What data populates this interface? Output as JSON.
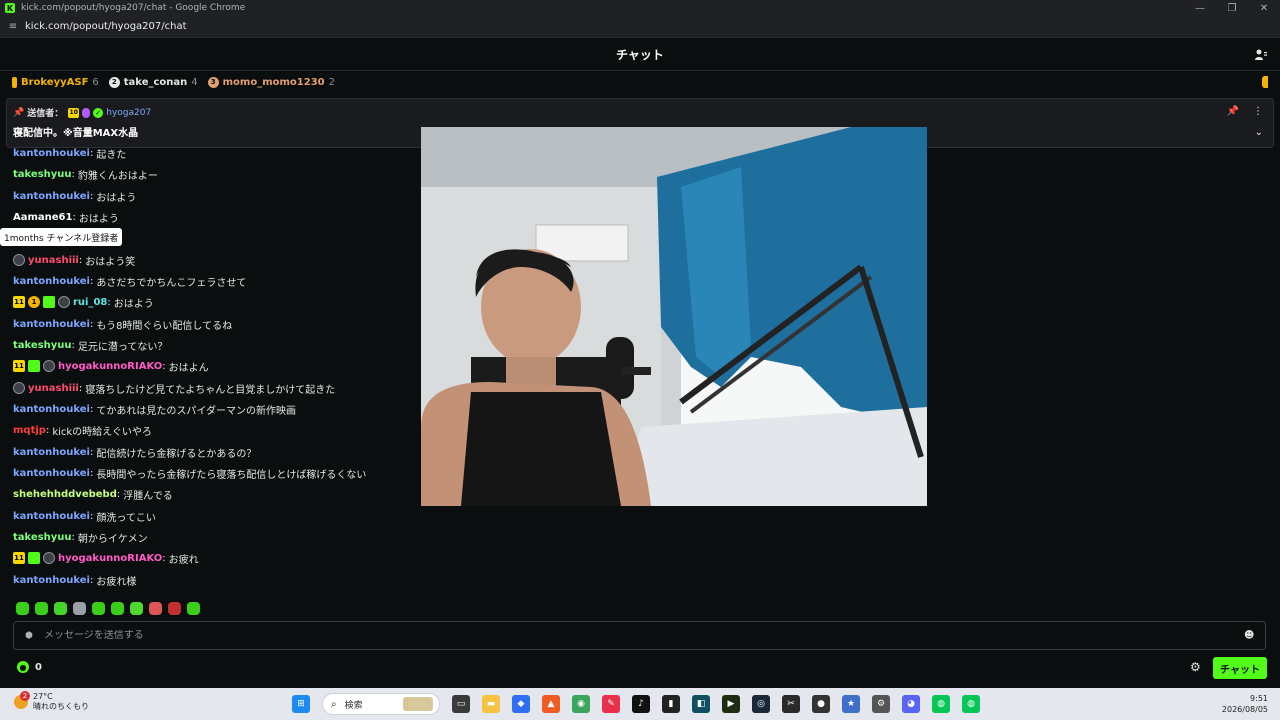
{
  "browser": {
    "window_title": "kick.com/popout/hyoga207/chat - Google Chrome",
    "url": "kick.com/popout/hyoga207/chat"
  },
  "header": {
    "title": "チャット"
  },
  "leaderboard": [
    {
      "rank": "",
      "name": "BrokeyyASF",
      "count": "6",
      "color": "#f5b400"
    },
    {
      "rank": "2",
      "name": "take_conan",
      "count": "4",
      "color": "#e6e6e6"
    },
    {
      "rank": "3",
      "name": "momo_momo1230",
      "count": "2",
      "color": "#e0a070"
    }
  ],
  "pinned": {
    "sender_label": "送信者：",
    "sub_badge": "10",
    "username": "hyoga207",
    "message": "寝配信中。※音量MAX水晶"
  },
  "tooltip": "1months チャンネル登録者",
  "messages": [
    {
      "badges": [],
      "user": "kantonhoukei",
      "color": "#7ea6ff",
      "text": "起きた"
    },
    {
      "badges": [],
      "user": "takeshyuu",
      "color": "#7cff7c",
      "text": "豹雅くんおはよー"
    },
    {
      "badges": [],
      "user": "kantonhoukei",
      "color": "#7ea6ff",
      "text": "おはよう"
    },
    {
      "badges": [],
      "user": "Aamane61",
      "color": "#ffffff",
      "text": "おはよう"
    },
    {
      "badges": [
        "avatar"
      ],
      "user": "yunashiii",
      "color": "#ff4d6d",
      "text": "おはよう笑"
    },
    {
      "badges": [],
      "user": "kantonhoukei",
      "color": "#7ea6ff",
      "text": "あさだちでかちんこフェラさせて"
    },
    {
      "badges": [
        "sub11",
        "gold",
        "gift",
        "avatar"
      ],
      "user": "rui_08",
      "color": "#5ee6e6",
      "text": "おはよう"
    },
    {
      "badges": [],
      "user": "kantonhoukei",
      "color": "#7ea6ff",
      "text": "もう8時間ぐらい配信してるね"
    },
    {
      "badges": [],
      "user": "takeshyuu",
      "color": "#7cff7c",
      "text": "足元に潜ってない？"
    },
    {
      "badges": [
        "sub11",
        "gift",
        "avatar"
      ],
      "user": "hyogakunnoRIAKO",
      "color": "#ff5ac8",
      "text": "おはよん"
    },
    {
      "badges": [
        "avatar"
      ],
      "user": "yunashiii",
      "color": "#ff4d6d",
      "text": "寝落ちしたけど見てたよちゃんと目覚ましかけて起きた"
    },
    {
      "badges": [],
      "user": "kantonhoukei",
      "color": "#7ea6ff",
      "text": "てかあれは見たのスパイダーマンの新作映画"
    },
    {
      "badges": [],
      "user": "mqtjp",
      "color": "#ff3b3b",
      "text": "kickの時給えぐいやろ"
    },
    {
      "badges": [],
      "user": "kantonhoukei",
      "color": "#7ea6ff",
      "text": "配信続けたら金稼げるとかあるの？"
    },
    {
      "badges": [],
      "user": "kantonhoukei",
      "color": "#7ea6ff",
      "text": "長時間やったら金稼げたら寝落ち配信しとけば稼げるくない"
    },
    {
      "badges": [],
      "user": "shehehhddvebebd",
      "color": "#c6ff7c",
      "text": "浮腫んでる"
    },
    {
      "badges": [],
      "user": "kantonhoukei",
      "color": "#7ea6ff",
      "text": "顔洗ってこい"
    },
    {
      "badges": [],
      "user": "takeshyuu",
      "color": "#7cff7c",
      "text": "朝からイケメン"
    },
    {
      "badges": [
        "sub11",
        "gift",
        "avatar"
      ],
      "user": "hyogakunnoRIAKO",
      "color": "#ff5ac8",
      "text": "お疲れ"
    },
    {
      "badges": [],
      "user": "kantonhoukei",
      "color": "#7ea6ff",
      "text": "お疲れ様"
    }
  ],
  "badge_labels": {
    "sub11": "11",
    "gold": "1",
    "gift": "",
    "avatar": ""
  },
  "input": {
    "placeholder": "メッセージを送信する"
  },
  "footer": {
    "points": "0",
    "send_label": "チャット"
  },
  "taskbar": {
    "notification_count": "2",
    "temperature": "27°C",
    "weather_text": "晴れのちくもり",
    "search_placeholder": "検索",
    "time": "9:51",
    "date": "2026/08/05"
  }
}
